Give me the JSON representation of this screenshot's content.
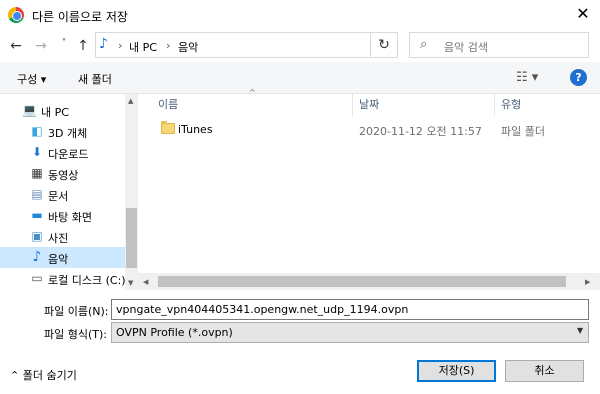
{
  "window": {
    "title": "다른 이름으로 저장",
    "close_glyph": "✕"
  },
  "nav": {
    "back": "←",
    "forward": "→",
    "recent": "˅",
    "up": "↑",
    "refresh": "↻"
  },
  "address": {
    "music_glyph": "♪",
    "sep1": "›",
    "pc": "내 PC",
    "sep2": "›",
    "folder": "음악"
  },
  "search": {
    "placeholder": "음악 검색",
    "icon_glyph": "⌕"
  },
  "toolbar": {
    "organize": "구성 ▾",
    "new_folder": "새 폴더",
    "view_glyph": "☷ ▾",
    "help": "?"
  },
  "sidebar": {
    "items": [
      {
        "label": "내 PC",
        "glyph": "💻"
      },
      {
        "label": "3D 개체",
        "glyph": "◧"
      },
      {
        "label": "다운로드",
        "glyph": "⬇"
      },
      {
        "label": "동영상",
        "glyph": "▦"
      },
      {
        "label": "문서",
        "glyph": "▤"
      },
      {
        "label": "바탕 화면",
        "glyph": "▬"
      },
      {
        "label": "사진",
        "glyph": "▣"
      },
      {
        "label": "음악",
        "glyph": "♪"
      },
      {
        "label": "로컬 디스크 (C:)",
        "glyph": "▭"
      }
    ],
    "up_arrow": "▲",
    "down_arrow": "▼"
  },
  "columns": {
    "name": "이름",
    "date": "날짜",
    "type": "유형",
    "sort_glyph": "^"
  },
  "files": [
    {
      "name": "iTunes",
      "date": "2020-11-12 오전 11:57",
      "type": "파일 폴더"
    }
  ],
  "hscroll": {
    "left": "◀",
    "right": "▶"
  },
  "form": {
    "filename_label": "파일 이름(N):",
    "filename_value": "vpngate_vpn404405341.opengw.net_udp_1194.ovpn",
    "filetype_label": "파일 형식(T):",
    "filetype_value": "OVPN Profile (*.ovpn)",
    "dropdown_glyph": "▼"
  },
  "footer": {
    "hide_folders": "⌃  폴더 숨기기",
    "save": "저장(S)",
    "cancel": "취소"
  },
  "colors": {
    "accent": "#0078d7",
    "selection": "#cce8ff",
    "help_bg": "#1f6fd1"
  }
}
